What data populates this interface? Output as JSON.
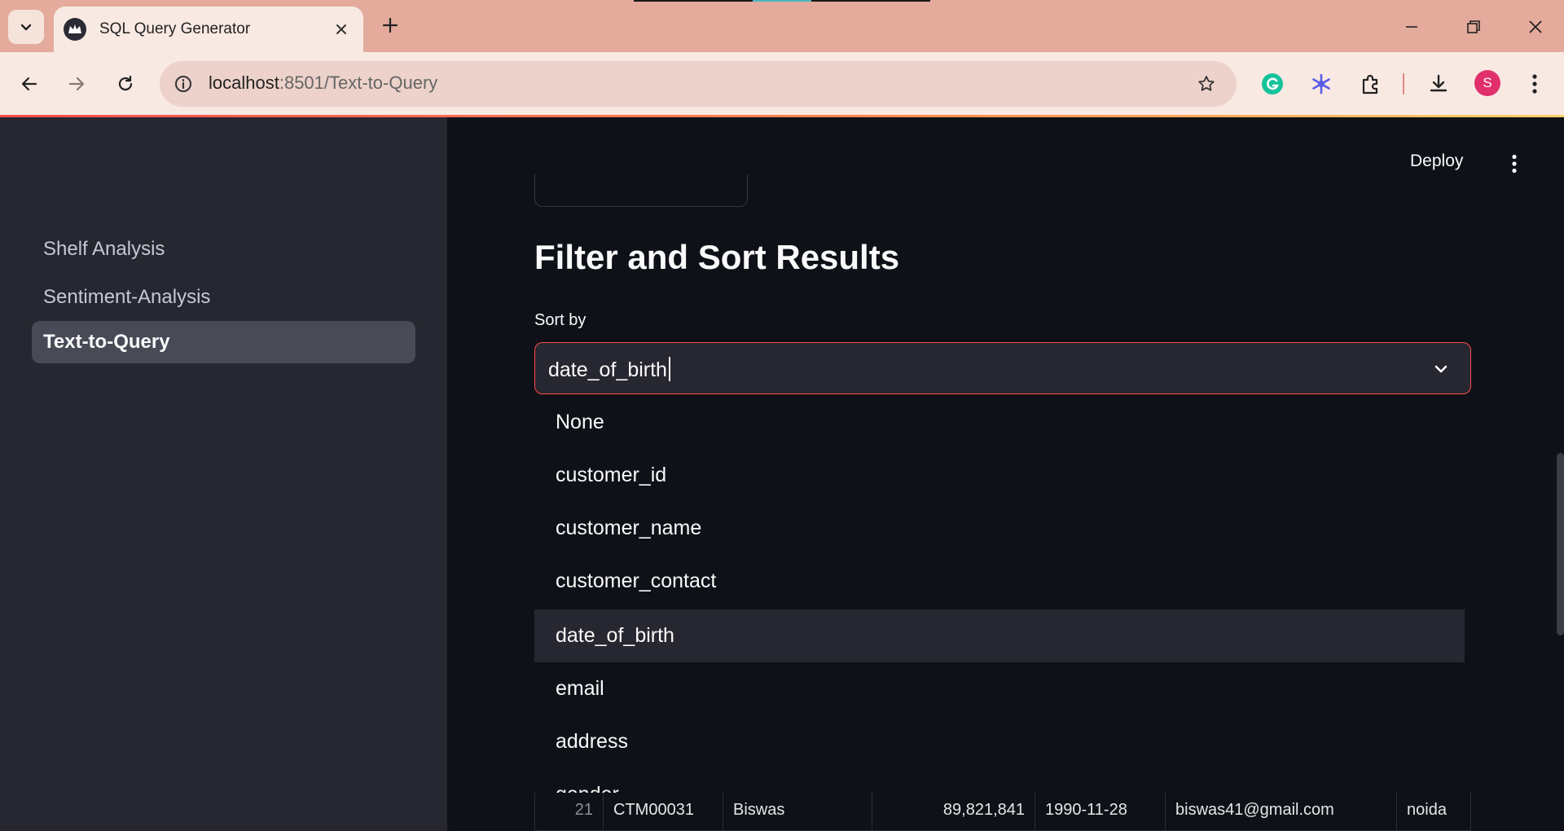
{
  "browser": {
    "tab_title": "SQL Query Generator",
    "url_host": "localhost",
    "url_path": ":8501/Text-to-Query",
    "profile_initial": "S"
  },
  "app": {
    "deploy_label": "Deploy",
    "sidebar": {
      "items": [
        {
          "label": "Shelf Analysis",
          "active": false
        },
        {
          "label": "Sentiment-Analysis",
          "active": false
        },
        {
          "label": "Text-to-Query",
          "active": true
        }
      ]
    },
    "heading": "Filter and Sort Results",
    "sort": {
      "label": "Sort by",
      "value": "date_of_birth",
      "options": [
        "None",
        "customer_id",
        "customer_name",
        "customer_contact",
        "date_of_birth",
        "email",
        "address",
        "gender"
      ],
      "highlighted": "date_of_birth"
    },
    "table_row": {
      "index": "21",
      "customer_id": "CTM00031",
      "customer_name": "Biswas",
      "customer_contact": "89,821,841",
      "date_of_birth": "1990-11-28",
      "email": "biswas41@gmail.com",
      "address": "noida"
    }
  },
  "colors": {
    "accent": "#ff4b4b",
    "sidebar_bg": "#262730",
    "main_bg": "#0e1117",
    "chrome_tabbar": "#e4ab9c"
  }
}
